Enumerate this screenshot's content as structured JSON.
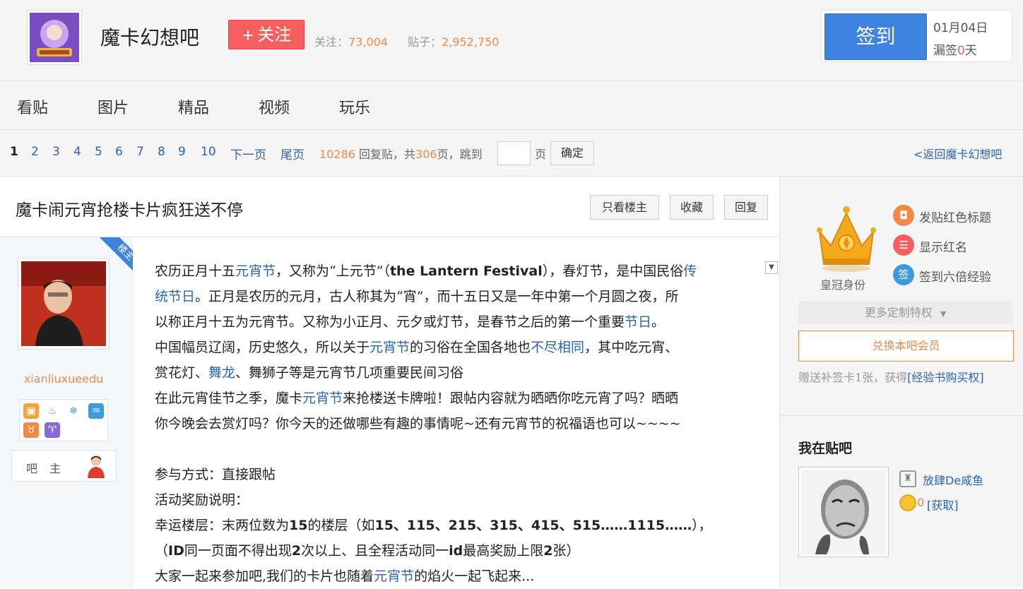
{
  "header": {
    "forum_name": "魔卡幻想吧",
    "follow_label": "关注",
    "follow_plus": "+",
    "followers_label": "关注：",
    "followers": "73,004",
    "posts_label": "贴子：",
    "posts": "2,952,750",
    "signin_label": "签到",
    "signin_date": "01月04日",
    "missed_prefix": "漏签",
    "missed_days": "0",
    "missed_suffix": "天"
  },
  "nav": {
    "items": [
      "看贴",
      "图片",
      "精品",
      "视频",
      "玩乐"
    ]
  },
  "pager": {
    "pages": [
      "1",
      "2",
      "3",
      "4",
      "5",
      "6",
      "7",
      "8",
      "9",
      "10"
    ],
    "next": "下一页",
    "last": "尾页",
    "replies": "10286",
    "replies_text": "回复贴，共",
    "total_pages": "306",
    "pages_text": "页，跳到",
    "page_unit": "页",
    "confirm": "确定",
    "back": "<返回魔卡幻想吧"
  },
  "post": {
    "title": "魔卡闹元宵抢楼卡片疯狂送不停",
    "only_op": "只看楼主",
    "favorite": "收藏",
    "reply": "回复",
    "op_badge": "楼主",
    "author": "xianliuxueedu",
    "role": "吧 主",
    "lines": {
      "l1a": "农历正月十五",
      "l1b": "元宵节",
      "l1c": "，又称为“上元节”（",
      "l1d": "the Lantern Festival",
      "l1e": "），春灯节，是中国民俗",
      "l1f": "传",
      "l2a": "统节日",
      "l2b": "。正月是农历的元月，古人称其为“宵”，而十五日又是一年中第一个月圆之夜，所",
      "l3a": "以称正月十五为元宵节。又称为小正月、元夕或灯节，是春节之后的第一个重要",
      "l3b": "节日",
      "l3c": "。",
      "l4a": "中国幅员辽阔，历史悠久，所以关于",
      "l4b": "元宵节",
      "l4c": "的习俗在全国各地也",
      "l4d": "不尽相同",
      "l4e": "，其中吃元宵、",
      "l5a": "赏花灯、",
      "l5b": "舞龙",
      "l5c": "、舞狮子等是元宵节几项重要民间习俗",
      "l6a": "在此元宵佳节之季，魔卡",
      "l6b": "元宵节",
      "l6c": "来抢楼送卡牌啦！跟帖内容就为晒晒你吃元宵了吗？晒晒",
      "l7a": "你今晚会去赏灯吗？你今天的还做哪些有趣的事情呢~还有元宵节的祝福语也可以~~~~",
      "l8a": "参与方式：直接跟帖",
      "l9a": "活动奖励说明：",
      "l10a": "幸运楼层：末两位数为",
      "l10b": "15",
      "l10c": "的楼层（如",
      "l10d": "15、115、215、315、415、515……1115……",
      "l10e": "），",
      "l11a": "（",
      "l11b": "ID",
      "l11c": "同一页面不得出现",
      "l11d": "2",
      "l11e": "次以上、且全程活动同一",
      "l11f": "id",
      "l11g": "最高奖励上限",
      "l11h": "2",
      "l11i": "张）",
      "l12a": "大家一起来参加吧,我们的卡片也随着",
      "l12b": "元宵节",
      "l12c": "的焰火一起飞起来..."
    }
  },
  "sidebar": {
    "crown_label": "皇冠身份",
    "privileges": [
      {
        "label": "发贴红色标题",
        "icon": "bookmark-icon",
        "color": "#f08a46",
        "glyph": "◘"
      },
      {
        "label": "显示红名",
        "icon": "chat-icon",
        "color": "#f55f5f",
        "glyph": "☰"
      },
      {
        "label": "签到六倍经验",
        "icon": "sign-icon",
        "color": "#3c9be0",
        "glyph": "签"
      }
    ],
    "more": "更多定制特权",
    "redeem": "兑换本吧会员",
    "gift_text": "赠送补签卡1张，获得",
    "gift_link": "[经验书购买权]",
    "my_forum_title": "我在贴吧",
    "username": "放肆De咸鱼",
    "coins": "0",
    "get": "[获取]"
  },
  "colors": {
    "accent_blue": "#3c84e0",
    "follow_red": "#f55f5f",
    "orange": "#f08a46",
    "link": "#2d64b3"
  }
}
